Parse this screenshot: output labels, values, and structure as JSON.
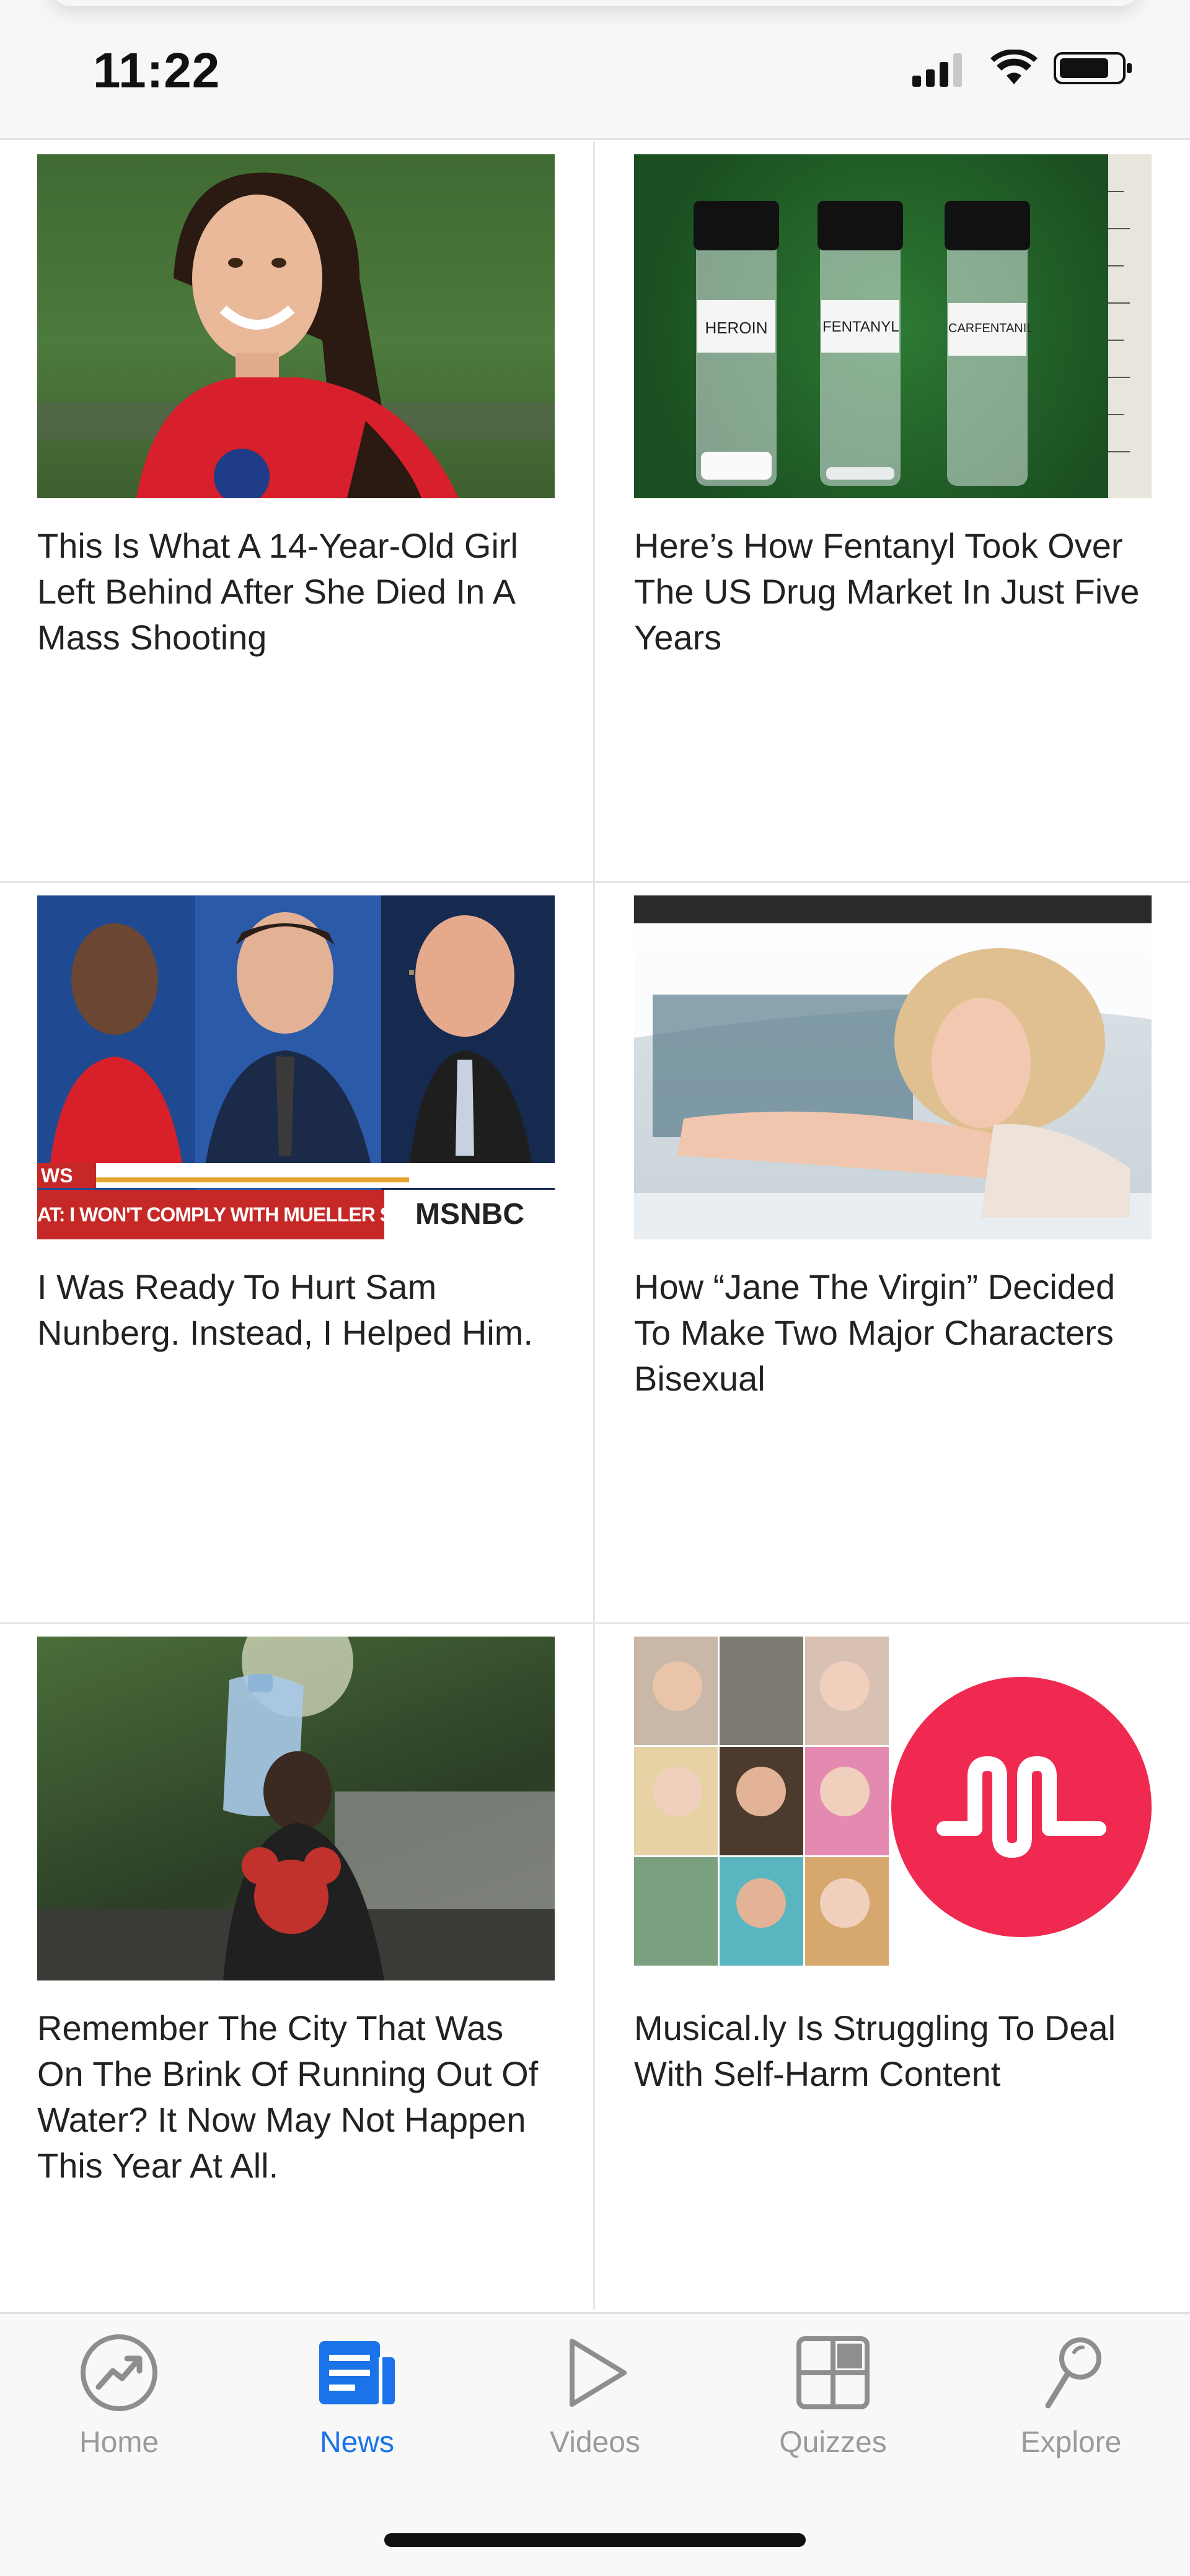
{
  "status_bar": {
    "time": "11:22"
  },
  "articles": [
    {
      "headline": "This Is What A 14-Year-Old Girl Left Behind After She Died In A Mass Shooting",
      "thumb_desc": "girl-portrait"
    },
    {
      "headline": "Here’s How Fentanyl Took Over The US Drug Market In Just Five Years",
      "thumb_desc": "vials",
      "vial_labels": [
        "HEROIN",
        "FENTANYL",
        "CARFENTANIL"
      ]
    },
    {
      "headline": "I Was Ready To Hurt Sam Nunberg. Instead, I Helped Him.",
      "thumb_desc": "tv-news",
      "ticker_left": "WS",
      "ticker_text": "AT: I WON'T COMPLY WITH MUELLER SUBPOENA",
      "network": "MSNBC"
    },
    {
      "headline": "How “Jane The Virgin” Decided To Make Two Major Characters Bisexual",
      "thumb_desc": "woman-driving"
    },
    {
      "headline": "Remember The City That Was On The Brink Of Running Out Of Water? It Now May Not Happen This Year At All.",
      "thumb_desc": "man-water-jug"
    },
    {
      "headline": "Musical.ly Is Struggling To Deal With Self-Harm Content",
      "thumb_desc": "musically-logo"
    }
  ],
  "tabbar": {
    "tabs": [
      {
        "label": "Home",
        "icon": "trending-icon",
        "active": false
      },
      {
        "label": "News",
        "icon": "news-icon",
        "active": true
      },
      {
        "label": "Videos",
        "icon": "play-icon",
        "active": false
      },
      {
        "label": "Quizzes",
        "icon": "quiz-grid-icon",
        "active": false
      },
      {
        "label": "Explore",
        "icon": "explore-magnifier-icon",
        "active": false
      }
    ]
  },
  "colors": {
    "accent": "#1a73e8",
    "inactive": "#9a9a9a",
    "musically_red": "#ef2950"
  }
}
